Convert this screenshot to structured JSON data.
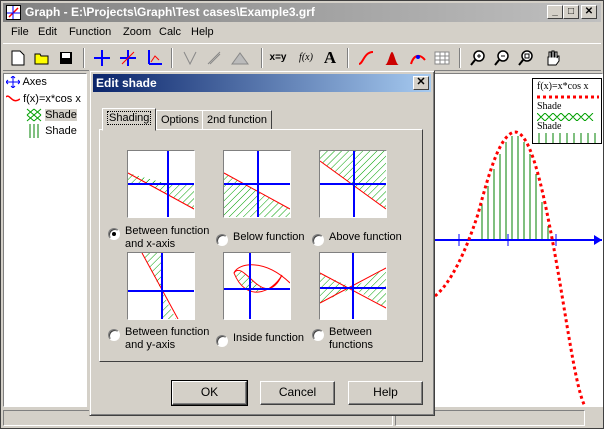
{
  "window": {
    "title": "Graph - E:\\Projects\\Graph\\Test cases\\Example3.grf",
    "minimize": "_",
    "maximize": "□",
    "close": "✕"
  },
  "menu": [
    "File",
    "Edit",
    "Function",
    "Zoom",
    "Calc",
    "Help"
  ],
  "toolbar": {
    "items": [
      "new-icon",
      "open-icon",
      "save-icon",
      "axes-icon",
      "axes-insert-icon",
      "axes-scale-icon",
      "tangent-icon",
      "relation-icon",
      "shade-icon",
      "xy-icon",
      "fx-icon",
      "text-icon",
      "function-icon",
      "shade-fn-icon",
      "point-series-icon",
      "table-icon",
      "zoom-in-icon",
      "zoom-out-icon",
      "zoom-fit-icon",
      "hand-icon"
    ],
    "xy_label": "x=y",
    "fx_label": "f(x)",
    "text_label": "A"
  },
  "tree": {
    "axes": "Axes",
    "func": "f(x)=x*cos x",
    "shade1": "Shade",
    "shade2": "Shade"
  },
  "legend": {
    "func": "f(x)=x*cos x",
    "shade1": "Shade",
    "shade2": "Shade"
  },
  "colors": {
    "function": "#ff0000",
    "shade1": "#00a000",
    "shade2": "#008000",
    "axis": "#0000ff",
    "dialog_title": "#0a246a"
  },
  "dialog": {
    "title": "Edit shade",
    "close": "✕",
    "tabs": [
      "Shading",
      "Options",
      "2nd function"
    ],
    "active_tab": "Shading",
    "options": [
      {
        "label": "Between function and x-axis",
        "selected": true
      },
      {
        "label": "Below function",
        "selected": false
      },
      {
        "label": "Above function",
        "selected": false
      },
      {
        "label": "Between function and y-axis",
        "selected": false
      },
      {
        "label": "Inside function",
        "selected": false
      },
      {
        "label": "Between functions",
        "selected": false
      }
    ],
    "buttons": {
      "ok": "OK",
      "cancel": "Cancel",
      "help": "Help"
    }
  }
}
